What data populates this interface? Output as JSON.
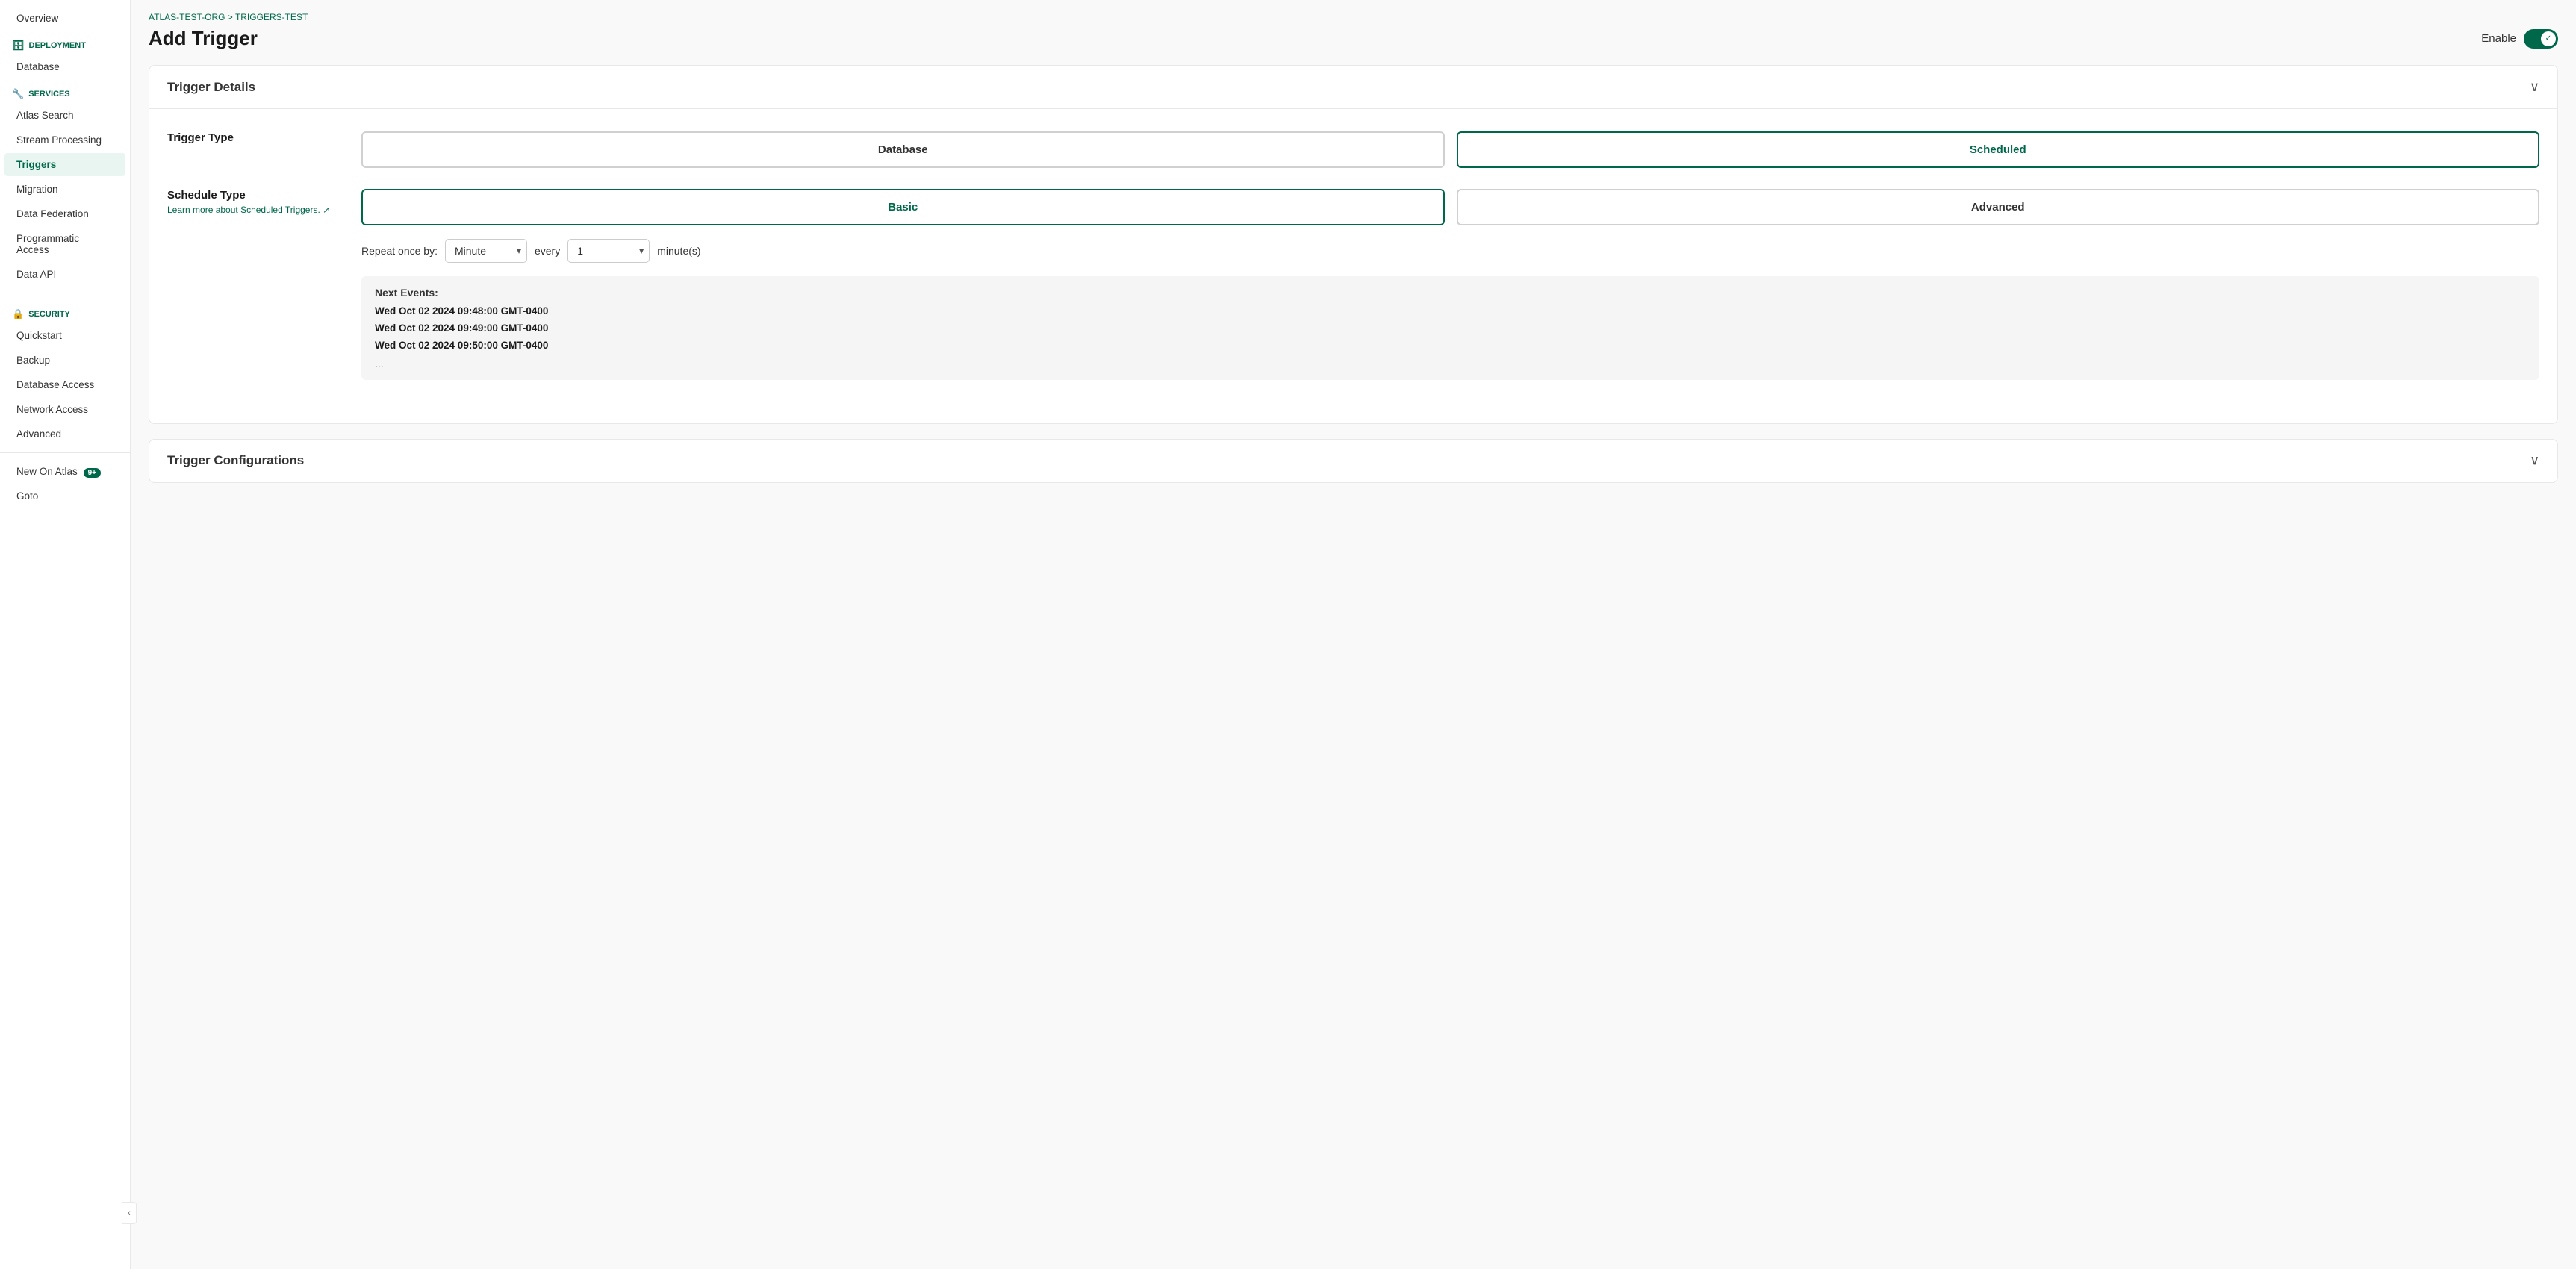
{
  "sidebar": {
    "deployment_label": "DEPLOYMENT",
    "database_label": "Database",
    "services_label": "SERVICES",
    "items": [
      {
        "label": "Overview",
        "id": "overview",
        "active": false
      },
      {
        "label": "Atlas Search",
        "id": "atlas-search",
        "active": false
      },
      {
        "label": "Stream Processing",
        "id": "stream-processing",
        "active": false
      },
      {
        "label": "Triggers",
        "id": "triggers",
        "active": true
      },
      {
        "label": "Migration",
        "id": "migration",
        "active": false
      },
      {
        "label": "Data Federation",
        "id": "data-federation",
        "active": false
      },
      {
        "label": "Programmatic Access",
        "id": "programmatic-access",
        "active": false
      },
      {
        "label": "Data API",
        "id": "data-api",
        "active": false
      }
    ],
    "security_label": "SECURITY",
    "security_items": [
      {
        "label": "Quickstart",
        "id": "quickstart",
        "active": false
      },
      {
        "label": "Backup",
        "id": "backup",
        "active": false
      },
      {
        "label": "Database Access",
        "id": "database-access",
        "active": false
      },
      {
        "label": "Network Access",
        "id": "network-access",
        "active": false
      },
      {
        "label": "Advanced",
        "id": "advanced",
        "active": false
      }
    ],
    "new_on_atlas_label": "New On Atlas",
    "new_on_atlas_badge": "9+",
    "goto_label": "Goto"
  },
  "header": {
    "breadcrumb_org": "ATLAS-TEST-ORG",
    "breadcrumb_separator": " > ",
    "breadcrumb_cluster": "TRIGGERS-TEST",
    "page_title": "Add Trigger",
    "enable_label": "Enable",
    "collapse_icon": "‹"
  },
  "trigger_details": {
    "section_title": "Trigger Details",
    "trigger_type_label": "Trigger Type",
    "database_btn": "Database",
    "scheduled_btn": "Scheduled",
    "schedule_type_label": "Schedule Type",
    "learn_more_link": "Learn more about Scheduled Triggers.",
    "basic_btn": "Basic",
    "advanced_btn": "Advanced",
    "repeat_once_by_label": "Repeat once by:",
    "minute_option": "Minute",
    "every_label": "every",
    "interval_value": "1",
    "minutes_suffix": "minute(s)",
    "next_events_title": "Next Events:",
    "event1": "Wed Oct 02 2024 09:48:00 GMT-0400",
    "event2": "Wed Oct 02 2024 09:49:00 GMT-0400",
    "event3": "Wed Oct 02 2024 09:50:00 GMT-0400",
    "ellipsis": "..."
  },
  "trigger_configurations": {
    "section_title": "Trigger Configurations"
  }
}
